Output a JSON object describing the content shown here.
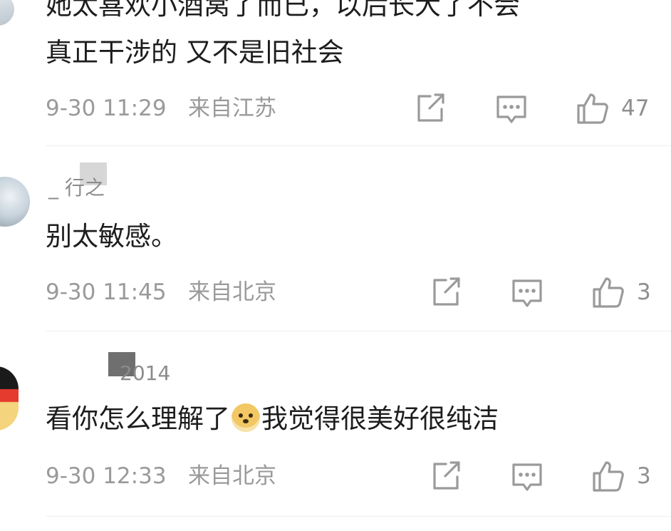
{
  "comments": [
    {
      "text_lines": [
        "她太喜欢小酒窝了而已，以后长大了不会",
        "真正干涉的 又不是旧社会"
      ],
      "time": "9-30 11:29",
      "location": "来自江苏",
      "likes": "47"
    },
    {
      "username": "_ 行之",
      "text": "别太敏感。",
      "time": "9-30 11:45",
      "location": "来自北京",
      "likes": "3"
    },
    {
      "username": "2014",
      "text_before": "看你怎么理解了",
      "text_after": "我觉得很美好很纯洁",
      "time": "9-30 12:33",
      "location": "来自北京",
      "likes": "3"
    }
  ],
  "icons": {
    "share": "share-icon",
    "comment": "comment-icon",
    "like": "thumbs-up-icon",
    "emoji": "doge-emoji-icon"
  },
  "colors": {
    "meta": "#9a9a9a",
    "text": "#1d1d1d",
    "icon": "#9a9a9a",
    "divider": "#efefef"
  }
}
